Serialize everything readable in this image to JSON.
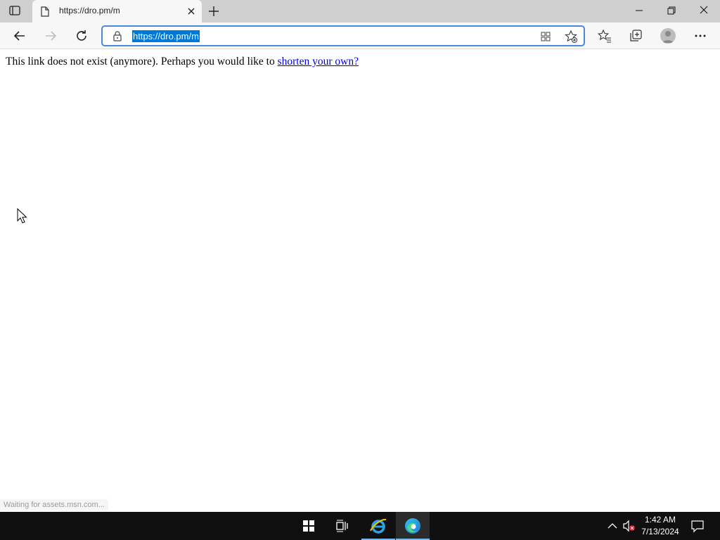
{
  "browser": {
    "tab": {
      "title": "https://dro.pm/m",
      "icon": "page-icon"
    },
    "address_bar": {
      "url": "https://dro.pm/m",
      "icon": "lock-icon"
    },
    "toolbar_icons": [
      "back-icon",
      "forward-icon",
      "refresh-icon",
      "app-available-icon",
      "add-favorite-icon",
      "favorites-icon",
      "collections-icon",
      "profile-icon",
      "more-icon"
    ]
  },
  "page": {
    "message": "This link does not exist (anymore). Perhaps you would like to ",
    "link_text": "shorten your own?",
    "status_text": "Waiting for assets.msn.com..."
  },
  "taskbar": {
    "apps": [
      "start-icon",
      "task-view-icon",
      "internet-explorer-icon",
      "edge-icon"
    ],
    "active_app": "edge-icon",
    "tray_icons": [
      "show-hidden-icons-icon",
      "volume-muted-icon",
      "notifications-icon"
    ],
    "clock": {
      "time": "1:42 AM",
      "date": "7/13/2024"
    }
  },
  "colors": {
    "selection": "#0078d7",
    "link": "#0000ee",
    "focus_ring": "#4a88d8",
    "taskbar": "#101010"
  }
}
